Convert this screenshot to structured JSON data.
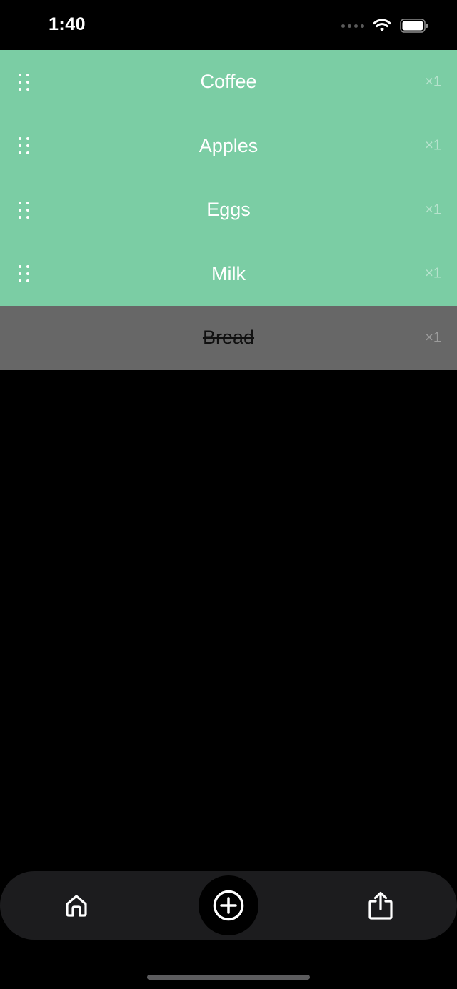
{
  "status_bar": {
    "time": "1:40"
  },
  "items": [
    {
      "name": "Coffee",
      "qty": "×1",
      "done": false
    },
    {
      "name": "Apples",
      "qty": "×1",
      "done": false
    },
    {
      "name": "Eggs",
      "qty": "×1",
      "done": false
    },
    {
      "name": "Milk",
      "qty": "×1",
      "done": false
    },
    {
      "name": "Bread",
      "qty": "×1",
      "done": true
    }
  ],
  "tab_bar": {
    "icons": [
      "home-icon",
      "add-circle-icon",
      "share-icon"
    ]
  },
  "colors": {
    "active_row": "#7bcda4",
    "done_row": "#676767",
    "background": "#000000",
    "tab_bar": "#1c1c1e"
  }
}
